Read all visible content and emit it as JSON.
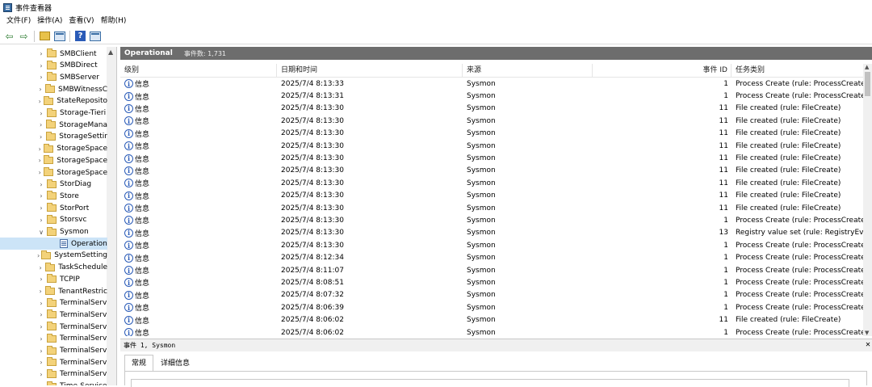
{
  "window": {
    "title": "事件查看器"
  },
  "menu": [
    "文件(F)",
    "操作(A)",
    "查看(V)",
    "帮助(H)"
  ],
  "tree": {
    "items": [
      {
        "label": "SMBClient",
        "expanded": false
      },
      {
        "label": "SMBDirect",
        "expanded": false
      },
      {
        "label": "SMBServer",
        "expanded": false
      },
      {
        "label": "SMBWitnessC",
        "expanded": false
      },
      {
        "label": "StateReposito",
        "expanded": false
      },
      {
        "label": "Storage-Tieri",
        "expanded": false
      },
      {
        "label": "StorageMana",
        "expanded": false
      },
      {
        "label": "StorageSettir",
        "expanded": false
      },
      {
        "label": "StorageSpace",
        "expanded": false
      },
      {
        "label": "StorageSpace",
        "expanded": false
      },
      {
        "label": "StorageSpace",
        "expanded": false
      },
      {
        "label": "StorDiag",
        "expanded": false
      },
      {
        "label": "Store",
        "expanded": false
      },
      {
        "label": "StorPort",
        "expanded": false
      },
      {
        "label": "Storsvc",
        "expanded": false
      },
      {
        "label": "Sysmon",
        "expanded": true
      },
      {
        "label": "Operation",
        "child": true,
        "selected": true
      },
      {
        "label": "SystemSetting",
        "expanded": false
      },
      {
        "label": "TaskSchedule",
        "expanded": false
      },
      {
        "label": "TCPIP",
        "expanded": false
      },
      {
        "label": "TenantRestric",
        "expanded": false
      },
      {
        "label": "TerminalServ",
        "expanded": false
      },
      {
        "label": "TerminalServ",
        "expanded": false
      },
      {
        "label": "TerminalServ",
        "expanded": false
      },
      {
        "label": "TerminalServ",
        "expanded": false
      },
      {
        "label": "TerminalServ",
        "expanded": false
      },
      {
        "label": "TerminalServ",
        "expanded": false
      },
      {
        "label": "TerminalServ",
        "expanded": false
      },
      {
        "label": "Time-Service",
        "expanded": false
      }
    ]
  },
  "list": {
    "title": "Operational",
    "count": "事件数: 1,731",
    "columns": [
      "级别",
      "日期和时间",
      "来源",
      "事件 ID",
      "任务类别"
    ],
    "rows": [
      {
        "level": "信息",
        "date": "2025/7/4 8:13:33",
        "source": "Sysmon",
        "id": "1",
        "task": "Process Create (rule: ProcessCreate)"
      },
      {
        "level": "信息",
        "date": "2025/7/4 8:13:31",
        "source": "Sysmon",
        "id": "1",
        "task": "Process Create (rule: ProcessCreate)"
      },
      {
        "level": "信息",
        "date": "2025/7/4 8:13:30",
        "source": "Sysmon",
        "id": "11",
        "task": "File created (rule: FileCreate)"
      },
      {
        "level": "信息",
        "date": "2025/7/4 8:13:30",
        "source": "Sysmon",
        "id": "11",
        "task": "File created (rule: FileCreate)"
      },
      {
        "level": "信息",
        "date": "2025/7/4 8:13:30",
        "source": "Sysmon",
        "id": "11",
        "task": "File created (rule: FileCreate)"
      },
      {
        "level": "信息",
        "date": "2025/7/4 8:13:30",
        "source": "Sysmon",
        "id": "11",
        "task": "File created (rule: FileCreate)"
      },
      {
        "level": "信息",
        "date": "2025/7/4 8:13:30",
        "source": "Sysmon",
        "id": "11",
        "task": "File created (rule: FileCreate)"
      },
      {
        "level": "信息",
        "date": "2025/7/4 8:13:30",
        "source": "Sysmon",
        "id": "11",
        "task": "File created (rule: FileCreate)"
      },
      {
        "level": "信息",
        "date": "2025/7/4 8:13:30",
        "source": "Sysmon",
        "id": "11",
        "task": "File created (rule: FileCreate)"
      },
      {
        "level": "信息",
        "date": "2025/7/4 8:13:30",
        "source": "Sysmon",
        "id": "11",
        "task": "File created (rule: FileCreate)"
      },
      {
        "level": "信息",
        "date": "2025/7/4 8:13:30",
        "source": "Sysmon",
        "id": "11",
        "task": "File created (rule: FileCreate)"
      },
      {
        "level": "信息",
        "date": "2025/7/4 8:13:30",
        "source": "Sysmon",
        "id": "1",
        "task": "Process Create (rule: ProcessCreate)"
      },
      {
        "level": "信息",
        "date": "2025/7/4 8:13:30",
        "source": "Sysmon",
        "id": "13",
        "task": "Registry value set (rule: RegistryEve..."
      },
      {
        "level": "信息",
        "date": "2025/7/4 8:13:30",
        "source": "Sysmon",
        "id": "1",
        "task": "Process Create (rule: ProcessCreate)"
      },
      {
        "level": "信息",
        "date": "2025/7/4 8:12:34",
        "source": "Sysmon",
        "id": "1",
        "task": "Process Create (rule: ProcessCreate)"
      },
      {
        "level": "信息",
        "date": "2025/7/4 8:11:07",
        "source": "Sysmon",
        "id": "1",
        "task": "Process Create (rule: ProcessCreate)"
      },
      {
        "level": "信息",
        "date": "2025/7/4 8:08:51",
        "source": "Sysmon",
        "id": "1",
        "task": "Process Create (rule: ProcessCreate)"
      },
      {
        "level": "信息",
        "date": "2025/7/4 8:07:32",
        "source": "Sysmon",
        "id": "1",
        "task": "Process Create (rule: ProcessCreate)"
      },
      {
        "level": "信息",
        "date": "2025/7/4 8:06:39",
        "source": "Sysmon",
        "id": "1",
        "task": "Process Create (rule: ProcessCreate)"
      },
      {
        "level": "信息",
        "date": "2025/7/4 8:06:02",
        "source": "Sysmon",
        "id": "11",
        "task": "File created (rule: FileCreate)"
      },
      {
        "level": "信息",
        "date": "2025/7/4 8:06:02",
        "source": "Sysmon",
        "id": "1",
        "task": "Process Create (rule: ProcessCreate)"
      }
    ]
  },
  "detail": {
    "title": "事件 1, Sysmon",
    "tabs": [
      "常规",
      "详细信息"
    ]
  },
  "colors": {
    "header_bg": "#6d6d6d",
    "selection": "#cce4f7",
    "info_blue": "#2a5bb8"
  },
  "icons": [
    "back-arrow-icon",
    "forward-arrow-icon",
    "folder-icon",
    "properties-icon",
    "help-icon",
    "panel-icon",
    "info-icon",
    "close-icon"
  ]
}
